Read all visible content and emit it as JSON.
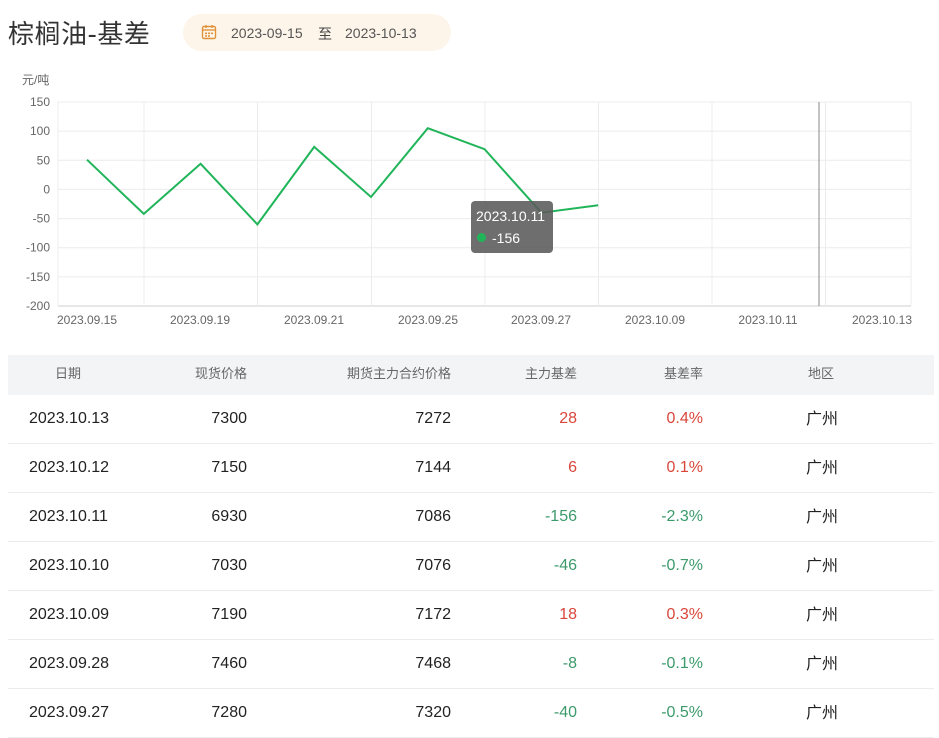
{
  "page": {
    "title": "棕榈油-基差",
    "date_start": "2023-09-15",
    "date_sep": "至",
    "date_end": "2023-10-13"
  },
  "colors": {
    "line": "#21b55a",
    "positive": "#d9463a",
    "negative": "#3c9a6b",
    "header_bg": "#f3f4f6",
    "range_bg": "#fdf5ea"
  },
  "chart_data": {
    "type": "line",
    "ylabel": "元/吨",
    "ylim": [
      -200,
      150
    ],
    "yticks": [
      150,
      100,
      50,
      0,
      -50,
      -100,
      -150,
      -200
    ],
    "xtick_labels": [
      "2023.09.15",
      "2023.09.19",
      "2023.09.21",
      "2023.09.25",
      "2023.09.27",
      "2023.10.09",
      "2023.10.11",
      "2023.10.13"
    ],
    "series": [
      {
        "x": [
          "2023.09.15",
          "2023.09.18",
          "2023.09.19",
          "2023.09.20",
          "2023.09.21",
          "2023.09.22",
          "2023.09.25",
          "2023.09.26",
          "2023.09.27",
          "2023.09.28"
        ],
        "values": [
          51,
          -42,
          44,
          -60,
          73,
          -13,
          105,
          69,
          -40,
          -27
        ]
      }
    ],
    "grid": true,
    "tooltip": {
      "date": "2023.10.11",
      "value": "-156"
    },
    "cursor_at": "2023.10.11"
  },
  "table": {
    "headers": [
      "日期",
      "现货价格",
      "期货主力合约价格",
      "主力基差",
      "基差率",
      "地区"
    ],
    "rows": [
      {
        "date": "2023.10.13",
        "spot": "7300",
        "futures": "7272",
        "basis": "28",
        "rate": "0.4%",
        "region": "广州",
        "sign": "pos"
      },
      {
        "date": "2023.10.12",
        "spot": "7150",
        "futures": "7144",
        "basis": "6",
        "rate": "0.1%",
        "region": "广州",
        "sign": "pos"
      },
      {
        "date": "2023.10.11",
        "spot": "6930",
        "futures": "7086",
        "basis": "-156",
        "rate": "-2.3%",
        "region": "广州",
        "sign": "neg"
      },
      {
        "date": "2023.10.10",
        "spot": "7030",
        "futures": "7076",
        "basis": "-46",
        "rate": "-0.7%",
        "region": "广州",
        "sign": "neg"
      },
      {
        "date": "2023.10.09",
        "spot": "7190",
        "futures": "7172",
        "basis": "18",
        "rate": "0.3%",
        "region": "广州",
        "sign": "pos"
      },
      {
        "date": "2023.09.28",
        "spot": "7460",
        "futures": "7468",
        "basis": "-8",
        "rate": "-0.1%",
        "region": "广州",
        "sign": "neg"
      },
      {
        "date": "2023.09.27",
        "spot": "7280",
        "futures": "7320",
        "basis": "-40",
        "rate": "-0.5%",
        "region": "广州",
        "sign": "neg"
      }
    ]
  }
}
